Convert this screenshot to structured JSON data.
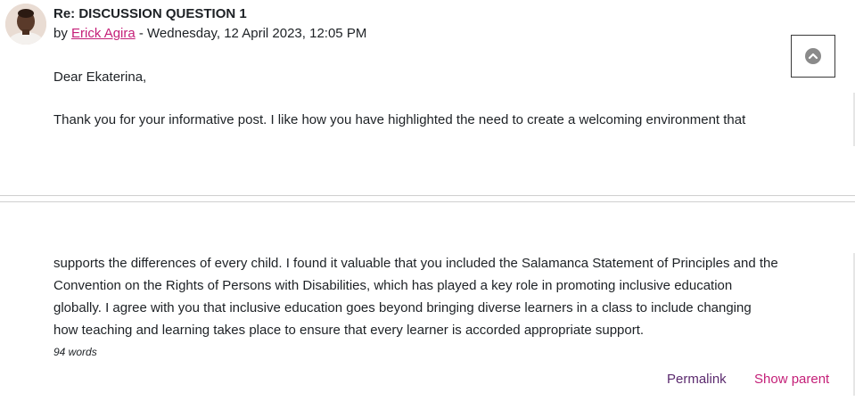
{
  "post": {
    "title": "Re: DISCUSSION QUESTION 1",
    "byline_prefix": "by ",
    "author": "Erick Agira",
    "byline_suffix": " - Wednesday, 12 April 2023, 12:05 PM",
    "greeting": "Dear Ekaterina,",
    "body_lines": [
      "Thank you for your informative post. I like how you have highlighted the need to create a welcoming environment that",
      "supports the differences of every child. I found it valuable that you included the Salamanca Statement of Principles and the",
      "Convention on the Rights of Persons with Disabilities, which has played a key role in promoting inclusive education",
      "globally. I agree with you that inclusive education goes beyond bringing diverse learners in a class to include changing",
      "how teaching and learning takes place to ensure that every learner is accorded appropriate support."
    ],
    "word_count": "94 words"
  },
  "actions": {
    "permalink": "Permalink",
    "show_parent": "Show parent"
  },
  "icons": {
    "scroll_top": "chevron-up-circle-icon",
    "avatar": "user-photo"
  },
  "colors": {
    "link_pink": "#c41f78",
    "permalink_purple": "#5b2a6e",
    "text": "#1d2125"
  }
}
